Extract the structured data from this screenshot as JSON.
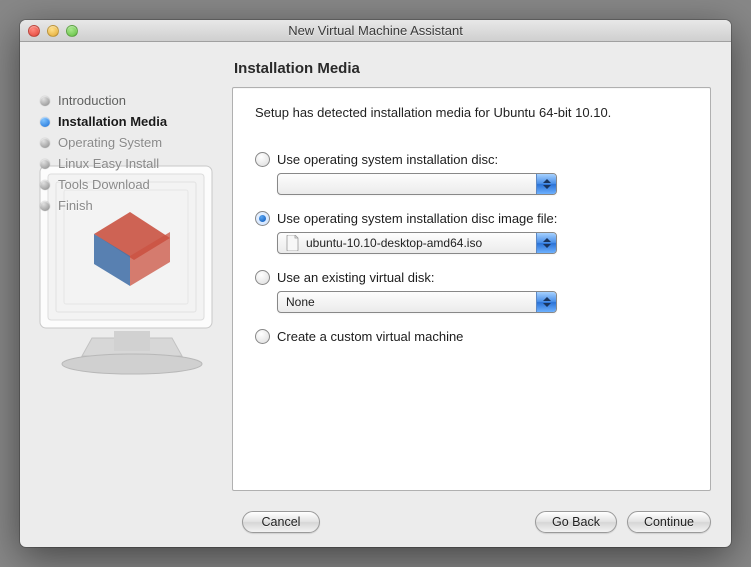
{
  "window": {
    "title": "New Virtual Machine Assistant"
  },
  "steps": [
    {
      "label": "Introduction",
      "state": "done"
    },
    {
      "label": "Installation Media",
      "state": "active"
    },
    {
      "label": "Operating System",
      "state": "pending"
    },
    {
      "label": "Linux Easy Install",
      "state": "pending"
    },
    {
      "label": "Tools Download",
      "state": "pending"
    },
    {
      "label": "Finish",
      "state": "pending"
    }
  ],
  "main": {
    "heading": "Installation Media",
    "detected_text": "Setup has detected installation media for Ubuntu 64-bit 10.10.",
    "options": {
      "disc": {
        "label": "Use operating system installation disc:",
        "value": ""
      },
      "image": {
        "label": "Use operating system installation disc image file:",
        "value": "ubuntu-10.10-desktop-amd64.iso"
      },
      "existing": {
        "label": "Use an existing virtual disk:",
        "value": "None"
      },
      "custom": {
        "label": "Create a custom virtual machine"
      }
    },
    "selected_option": "image"
  },
  "buttons": {
    "cancel": "Cancel",
    "goback": "Go Back",
    "continue": "Continue"
  }
}
